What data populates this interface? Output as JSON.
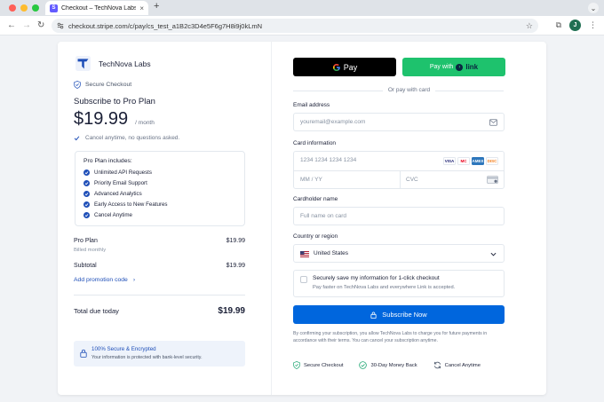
{
  "browser": {
    "tab_title": "Checkout – TechNova Labs",
    "tab_favicon_letter": "S",
    "new_tab_symbol": "+",
    "url": "checkout.stripe.com/c/pay/cs_test_a1B2c3D4e5F6g7H8i9j0kLmN",
    "profile_initial": "J"
  },
  "brand": {
    "name": "TechNova Labs"
  },
  "secure_checkout": "Secure Checkout",
  "plan": {
    "title": "Subscribe to Pro Plan",
    "price": "$19.99",
    "period": "/ month",
    "cancel_note": "Cancel anytime, no questions asked."
  },
  "includes": {
    "title": "Pro Plan includes:",
    "items": [
      "Unlimited API Requests",
      "Priority Email Support",
      "Advanced Analytics",
      "Early Access to New Features",
      "Cancel Anytime"
    ]
  },
  "summary": {
    "line_label": "Pro Plan",
    "line_value": "$19.99",
    "billed": "Billed monthly",
    "subtotal_label": "Subtotal",
    "subtotal_value": "$19.99",
    "promo": "Add promotion code",
    "total_label": "Total due today",
    "total_value": "$19.99"
  },
  "encryption": {
    "title": "100% Secure & Encrypted",
    "subtitle": "Your information is protected with bank-level security."
  },
  "payment": {
    "gpay_label": "Pay",
    "link_prefix": "Pay with",
    "link_label": "link",
    "or_text": "Or pay with card"
  },
  "form": {
    "email_label": "Email address",
    "email_placeholder": "youremail@example.com",
    "card_label": "Card information",
    "card_placeholder": "1234 1234 1234 1234",
    "expiry_placeholder": "MM / YY",
    "cvc_placeholder": "CVC",
    "card_brands": [
      "VISA",
      "MC",
      "AMEX",
      "DISC"
    ],
    "name_label": "Cardholder name",
    "name_placeholder": "Full name on card",
    "country_label": "Country or region",
    "country_value": "United States"
  },
  "save_info": {
    "title": "Securely save my information for 1-click checkout",
    "subtitle": "Pay faster on TechNova Labs and everywhere Link is accepted."
  },
  "subscribe_label": "Subscribe Now",
  "terms": "By confirming your subscription, you allow TechNova Labs to charge you for future payments in accordance with their terms. You can cancel your subscription anytime.",
  "badges": [
    "Secure Checkout",
    "30-Day Money Back",
    "Cancel Anytime"
  ],
  "colors": {
    "accent": "#0066dd",
    "link_green": "#1ec26d",
    "brand_blue": "#1f4fb8"
  }
}
